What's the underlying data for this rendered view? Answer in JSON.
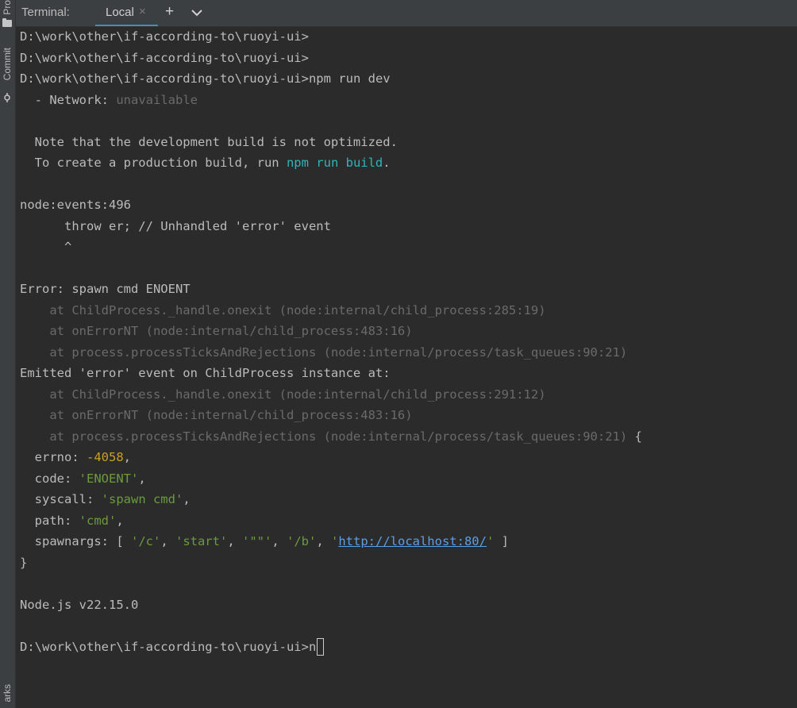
{
  "left_stripe": {
    "project_label": "Pro",
    "commit_label": "Commit",
    "bookmarks_label": "arks"
  },
  "header": {
    "title": "Terminal:",
    "tab_label": "Local",
    "close_glyph": "×",
    "add_glyph": "+"
  },
  "terminal": {
    "prompt_path": "D:\\work\\other\\if-according-to\\ruoyi-ui>",
    "command": "npm run dev",
    "network_label": "  - Network: ",
    "network_value": "unavailable",
    "note_line": "  Note that the development build is not optimized.",
    "prod_prefix": "  To create a production build, run ",
    "prod_cmd": "npm run build",
    "prod_suffix": ".",
    "events_line": "node:events:496",
    "throw_line": "      throw er; // Unhandled 'error' event",
    "caret_line": "      ^",
    "error_line": "Error: spawn cmd ENOENT",
    "stack1": "    at ChildProcess._handle.onexit (node:internal/child_process:285:19)",
    "stack2": "    at onErrorNT (node:internal/child_process:483:16)",
    "stack3": "    at process.processTicksAndRejections (node:internal/process/task_queues:90:21)",
    "emitted_line": "Emitted 'error' event on ChildProcess instance at:",
    "stack4": "    at ChildProcess._handle.onexit (node:internal/child_process:291:12)",
    "stack5": "    at onErrorNT (node:internal/child_process:483:16)",
    "stack6": "    at process.processTicksAndRejections (node:internal/process/task_queues:90:21)",
    "brace_open": " {",
    "errno_key": "  errno: ",
    "errno_val": "-4058",
    "comma": ",",
    "code_key": "  code: ",
    "code_val": "'ENOENT'",
    "syscall_key": "  syscall: ",
    "syscall_val": "'spawn cmd'",
    "path_key": "  path: ",
    "path_val": "'cmd'",
    "spawnargs_key": "  spawnargs: [ ",
    "arg1": "'/c'",
    "arg2": "'start'",
    "arg3": "'\"\"'",
    "arg4": "'/b'",
    "arg5_q": "'",
    "arg5_url": "http://localhost:80/",
    "sep": ", ",
    "array_close": " ]",
    "brace_close": "}",
    "node_version": "Node.js v22.15.0",
    "typed_input": "n"
  },
  "colors": {
    "background": "#2b2b2b",
    "text": "#bbbbbb",
    "dim": "#6a6a6a",
    "cyan": "#2fb5bb",
    "number": "#c9a01f",
    "string": "#6a9b3c",
    "link": "#5c9ee8",
    "tab_underline": "#4a88c7"
  },
  "icons": {
    "project": "folder-icon",
    "commit": "commit-icon",
    "tab_close": "close-icon",
    "new_tab": "plus-icon",
    "tab_menu": "chevron-down-icon"
  }
}
